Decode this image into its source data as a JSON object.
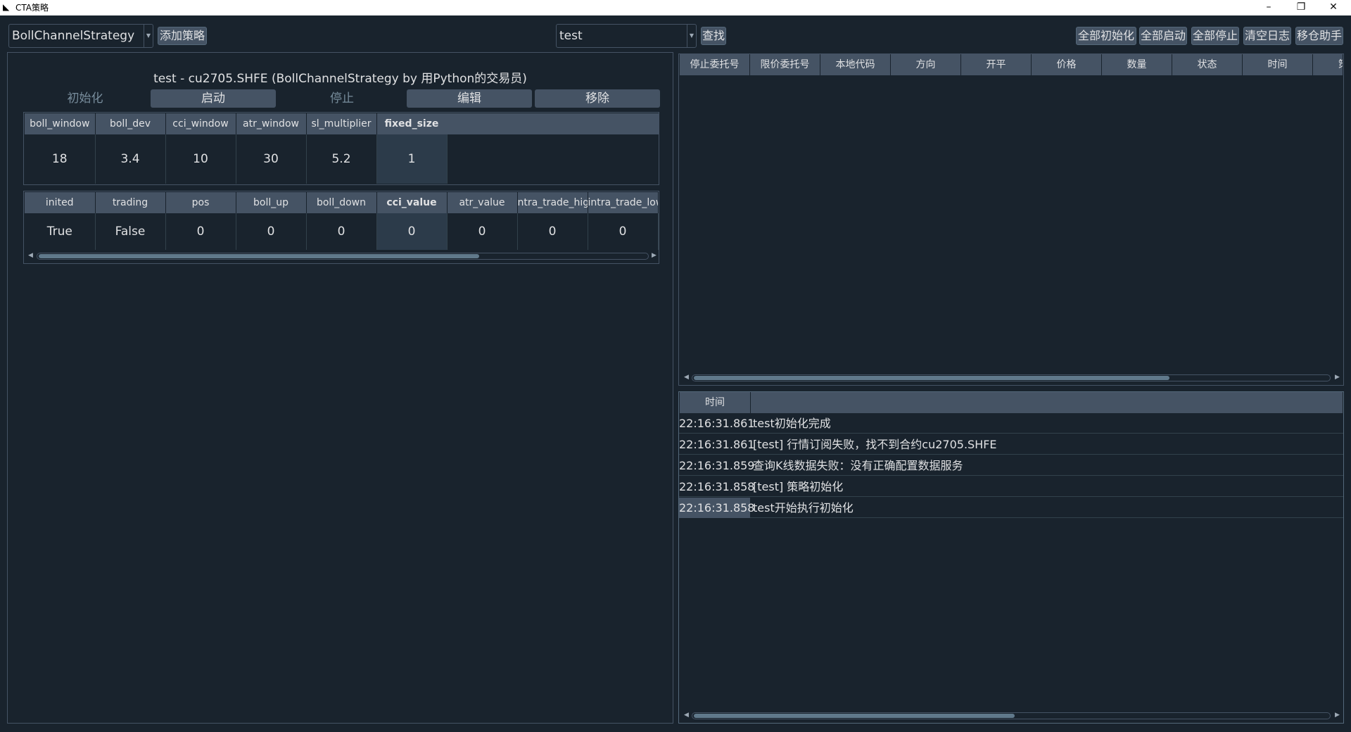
{
  "window": {
    "title": "CTA策略",
    "minimize": "–",
    "maximize": "❐",
    "close": "✕"
  },
  "toolbar": {
    "strategy_class": "BollChannelStrategy",
    "add_strategy": "添加策略",
    "search_value": "test",
    "find": "查找",
    "init_all": "全部初始化",
    "start_all": "全部启动",
    "stop_all": "全部停止",
    "clear_log": "清空日志",
    "roll_helper": "移仓助手"
  },
  "strategy": {
    "title": "test  -  cu2705.SHFE  (BollChannelStrategy by 用Python的交易员)",
    "controls": {
      "init": "初始化",
      "start": "启动",
      "stop": "停止",
      "edit": "编辑",
      "remove": "移除"
    },
    "params": {
      "headers": [
        "boll_window",
        "boll_dev",
        "cci_window",
        "atr_window",
        "sl_multiplier",
        "fixed_size"
      ],
      "values": [
        "18",
        "3.4",
        "10",
        "30",
        "5.2",
        "1"
      ]
    },
    "variables": {
      "headers": [
        "inited",
        "trading",
        "pos",
        "boll_up",
        "boll_down",
        "cci_value",
        "atr_value",
        "ntra_trade_high",
        "intra_trade_low"
      ],
      "values": [
        "True",
        "False",
        "0",
        "0",
        "0",
        "0",
        "0",
        "0",
        "0"
      ]
    }
  },
  "stop_orders": {
    "headers": [
      "停止委托号",
      "限价委托号",
      "本地代码",
      "方向",
      "开平",
      "价格",
      "数量",
      "状态",
      "时间",
      "策"
    ]
  },
  "log": {
    "header_time": "时间",
    "rows": [
      {
        "time": "22:16:31.861",
        "msg": "test初始化完成"
      },
      {
        "time": "22:16:31.861",
        "msg": "[test]  行情订阅失败，找不到合约cu2705.SHFE"
      },
      {
        "time": "22:16:31.859",
        "msg": "查询K线数据失败：没有正确配置数据服务"
      },
      {
        "time": "22:16:31.858",
        "msg": "[test]  策略初始化"
      },
      {
        "time": "22:16:31.858",
        "msg": "test开始执行初始化"
      }
    ]
  },
  "colors": {
    "background": "#19232d",
    "button": "#455364",
    "header": "#455364"
  }
}
